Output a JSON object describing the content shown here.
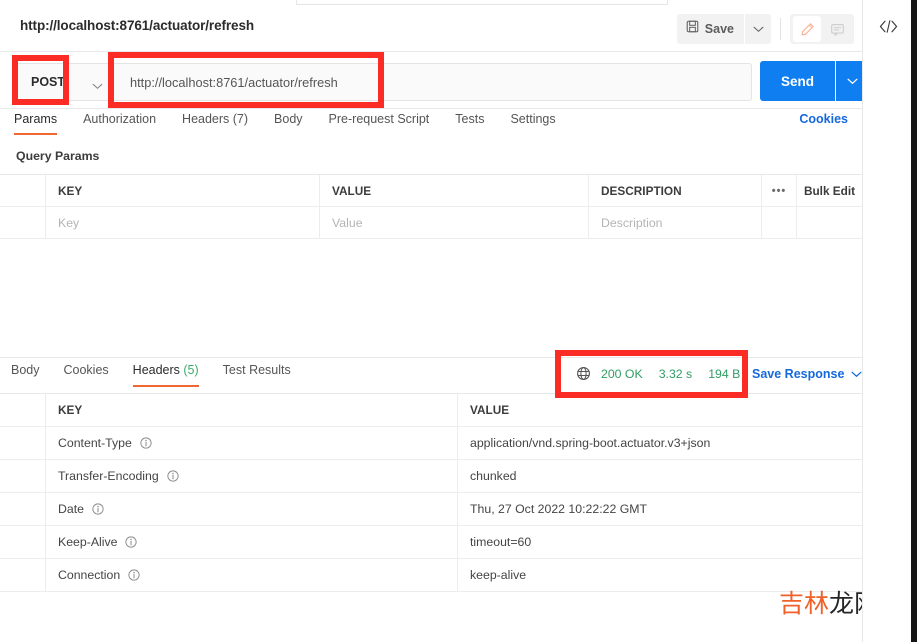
{
  "request": {
    "title": "http://localhost:8761/actuator/refresh",
    "method": "POST",
    "url": "http://localhost:8761/actuator/refresh",
    "send_label": "Send",
    "save_label": "Save"
  },
  "request_tabs": [
    {
      "label": "Params",
      "active": true
    },
    {
      "label": "Authorization",
      "active": false
    },
    {
      "label": "Headers (7)",
      "active": false
    },
    {
      "label": "Body",
      "active": false
    },
    {
      "label": "Pre-request Script",
      "active": false
    },
    {
      "label": "Tests",
      "active": false
    },
    {
      "label": "Settings",
      "active": false
    }
  ],
  "cookies_link": "Cookies",
  "query_params": {
    "section_label": "Query Params",
    "columns": [
      "KEY",
      "VALUE",
      "DESCRIPTION"
    ],
    "bulk_edit_label": "Bulk Edit",
    "placeholder_row": {
      "key": "Key",
      "value": "Value",
      "description": "Description"
    }
  },
  "response_tabs": [
    {
      "label": "Body",
      "active": false
    },
    {
      "label": "Cookies",
      "active": false
    },
    {
      "label": "Headers",
      "count": " (5)",
      "active": true
    },
    {
      "label": "Test Results",
      "active": false
    }
  ],
  "response_status": {
    "status": "200 OK",
    "time": "3.32 s",
    "size": "194 B",
    "save_response_label": "Save Response"
  },
  "response_headers": {
    "columns": [
      "KEY",
      "VALUE"
    ],
    "rows": [
      {
        "key": "Content-Type",
        "value": "application/vnd.spring-boot.actuator.v3+json"
      },
      {
        "key": "Transfer-Encoding",
        "value": "chunked"
      },
      {
        "key": "Date",
        "value": "Thu, 27 Oct 2022 10:22:22 GMT"
      },
      {
        "key": "Keep-Alive",
        "value": "timeout=60"
      },
      {
        "key": "Connection",
        "value": "keep-alive"
      }
    ]
  },
  "watermark": {
    "part1": "吉林",
    "part2": "龙网"
  },
  "colors": {
    "accent_orange": "#ef6733",
    "link_blue": "#1668dc",
    "send_blue": "#0f7ef1",
    "status_green": "#2f9e63",
    "annotation_red": "#fb2c26"
  }
}
